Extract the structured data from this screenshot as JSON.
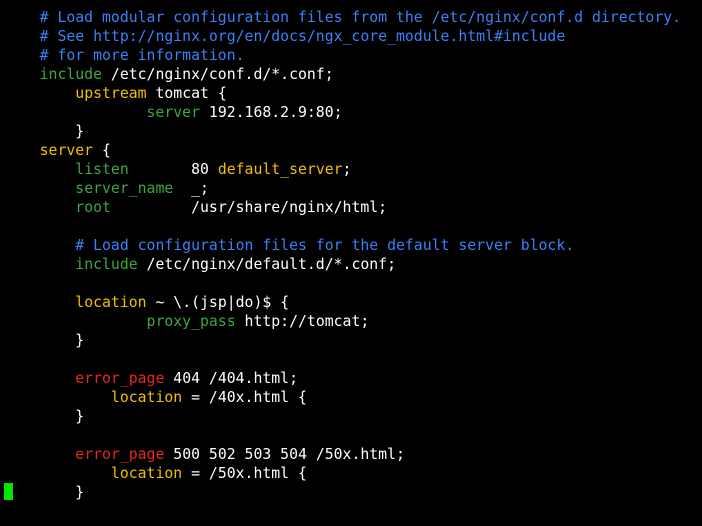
{
  "colors": {
    "background": "#000000",
    "default": "#ffffff",
    "comment": "#3a82f7",
    "keyword": "#3ea63e",
    "directive": "#f0c000",
    "value": "#ffffff",
    "error_directive": "#e8261f",
    "cursor": "#00e600"
  },
  "lines": [
    [
      {
        "t": "    ",
        "c": "default"
      },
      {
        "t": "# Load modular configuration files from the /etc/nginx/conf.d directory.",
        "c": "comment"
      }
    ],
    [
      {
        "t": "    ",
        "c": "default"
      },
      {
        "t": "# See http://nginx.org/en/docs/ngx_core_module.html#include",
        "c": "comment"
      }
    ],
    [
      {
        "t": "    ",
        "c": "default"
      },
      {
        "t": "# for more information.",
        "c": "comment"
      }
    ],
    [
      {
        "t": "    ",
        "c": "default"
      },
      {
        "t": "include",
        "c": "keyword"
      },
      {
        "t": " /etc/nginx/conf.d/*.conf;",
        "c": "value"
      }
    ],
    [
      {
        "t": "        ",
        "c": "default"
      },
      {
        "t": "upstream",
        "c": "directive"
      },
      {
        "t": " tomcat {",
        "c": "value"
      }
    ],
    [
      {
        "t": "                ",
        "c": "default"
      },
      {
        "t": "server",
        "c": "keyword"
      },
      {
        "t": " 192.168.2.9:80;",
        "c": "value"
      }
    ],
    [
      {
        "t": "        }",
        "c": "value"
      }
    ],
    [
      {
        "t": "    ",
        "c": "default"
      },
      {
        "t": "server",
        "c": "directive"
      },
      {
        "t": " {",
        "c": "value"
      }
    ],
    [
      {
        "t": "        ",
        "c": "default"
      },
      {
        "t": "listen",
        "c": "keyword"
      },
      {
        "t": "       80 ",
        "c": "value"
      },
      {
        "t": "default_server",
        "c": "directive"
      },
      {
        "t": ";",
        "c": "value"
      }
    ],
    [
      {
        "t": "        ",
        "c": "default"
      },
      {
        "t": "server_name",
        "c": "keyword"
      },
      {
        "t": "  _;",
        "c": "value"
      }
    ],
    [
      {
        "t": "        ",
        "c": "default"
      },
      {
        "t": "root",
        "c": "keyword"
      },
      {
        "t": "         /usr/share/nginx/html;",
        "c": "value"
      }
    ],
    [],
    [
      {
        "t": "        ",
        "c": "default"
      },
      {
        "t": "# Load configuration files for the default server block.",
        "c": "comment"
      }
    ],
    [
      {
        "t": "        ",
        "c": "default"
      },
      {
        "t": "include",
        "c": "keyword"
      },
      {
        "t": " /etc/nginx/default.d/*.conf;",
        "c": "value"
      }
    ],
    [],
    [
      {
        "t": "        ",
        "c": "default"
      },
      {
        "t": "location",
        "c": "directive"
      },
      {
        "t": " ~ \\.(jsp|do)$ {",
        "c": "value"
      }
    ],
    [
      {
        "t": "                ",
        "c": "default"
      },
      {
        "t": "proxy_pass",
        "c": "keyword"
      },
      {
        "t": " http://tomcat;",
        "c": "value"
      }
    ],
    [
      {
        "t": "        }",
        "c": "value"
      }
    ],
    [],
    [
      {
        "t": "        ",
        "c": "default"
      },
      {
        "t": "error_page",
        "c": "error_directive"
      },
      {
        "t": " 404 /404.html;",
        "c": "value"
      }
    ],
    [
      {
        "t": "            ",
        "c": "default"
      },
      {
        "t": "location",
        "c": "directive"
      },
      {
        "t": " = /40x.html {",
        "c": "value"
      }
    ],
    [
      {
        "t": "        }",
        "c": "value"
      }
    ],
    [],
    [
      {
        "t": "        ",
        "c": "default"
      },
      {
        "t": "error_page",
        "c": "error_directive"
      },
      {
        "t": " 500 502 503 504 /50x.html;",
        "c": "value"
      }
    ],
    [
      {
        "t": "            ",
        "c": "default"
      },
      {
        "t": "location",
        "c": "directive"
      },
      {
        "t": " = /50x.html {",
        "c": "value"
      }
    ],
    [
      {
        "t": "        }",
        "c": "value"
      }
    ]
  ]
}
